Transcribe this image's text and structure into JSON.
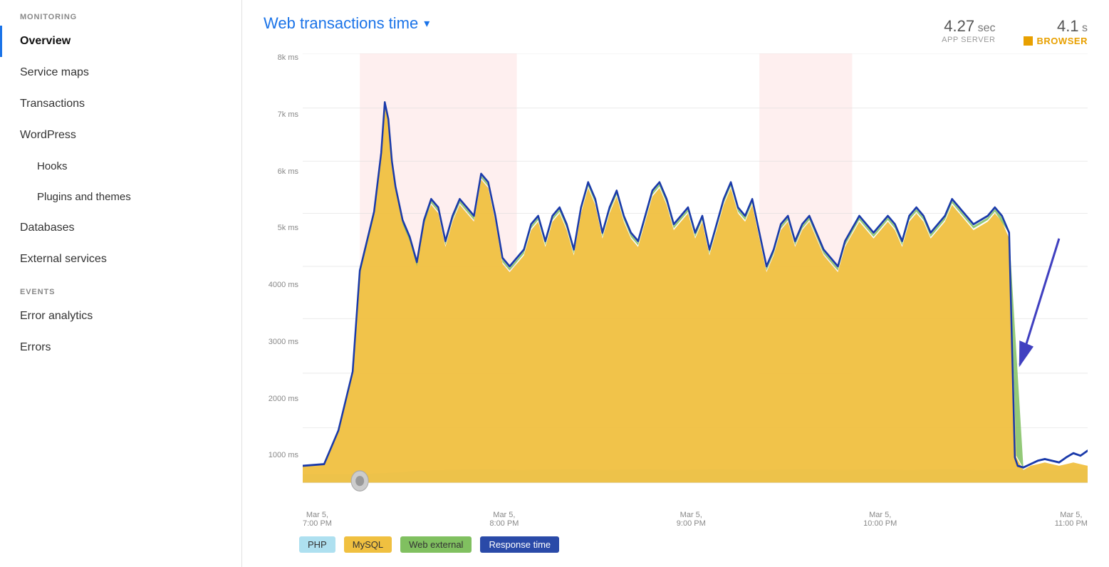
{
  "sidebar": {
    "monitoring_label": "MONITORING",
    "events_label": "EVENTS",
    "items": [
      {
        "id": "overview",
        "label": "Overview",
        "active": true,
        "sub": false
      },
      {
        "id": "service-maps",
        "label": "Service maps",
        "active": false,
        "sub": false
      },
      {
        "id": "transactions",
        "label": "Transactions",
        "active": false,
        "sub": false
      },
      {
        "id": "wordpress",
        "label": "WordPress",
        "active": false,
        "sub": false
      },
      {
        "id": "hooks",
        "label": "Hooks",
        "active": false,
        "sub": true
      },
      {
        "id": "plugins-themes",
        "label": "Plugins and themes",
        "active": false,
        "sub": true
      },
      {
        "id": "databases",
        "label": "Databases",
        "active": false,
        "sub": false
      },
      {
        "id": "external-services",
        "label": "External services",
        "active": false,
        "sub": false
      }
    ],
    "event_items": [
      {
        "id": "error-analytics",
        "label": "Error analytics",
        "active": false
      },
      {
        "id": "errors",
        "label": "Errors",
        "active": false
      }
    ]
  },
  "chart": {
    "title": "Web transactions time",
    "stat_app_server_value": "4.27",
    "stat_app_server_unit": "sec",
    "stat_app_server_label": "APP SERVER",
    "stat_browser_value": "4.1",
    "stat_browser_unit": "s",
    "stat_browser_label": "BROWSER",
    "y_labels": [
      "8k ms",
      "7k ms",
      "6k ms",
      "5k ms",
      "4000 ms",
      "3000 ms",
      "2000 ms",
      "1000 ms",
      ""
    ],
    "x_labels": [
      "Mar 5,\n7:00 PM",
      "Mar 5,\n8:00 PM",
      "Mar 5,\n9:00 PM",
      "Mar 5,\n10:00 PM",
      "Mar 5,\n11:00 PM"
    ],
    "legend": [
      {
        "id": "php",
        "label": "PHP",
        "class": "php"
      },
      {
        "id": "mysql",
        "label": "MySQL",
        "class": "mysql"
      },
      {
        "id": "web-external",
        "label": "Web external",
        "class": "webext"
      },
      {
        "id": "response-time",
        "label": "Response time",
        "class": "response"
      }
    ]
  }
}
